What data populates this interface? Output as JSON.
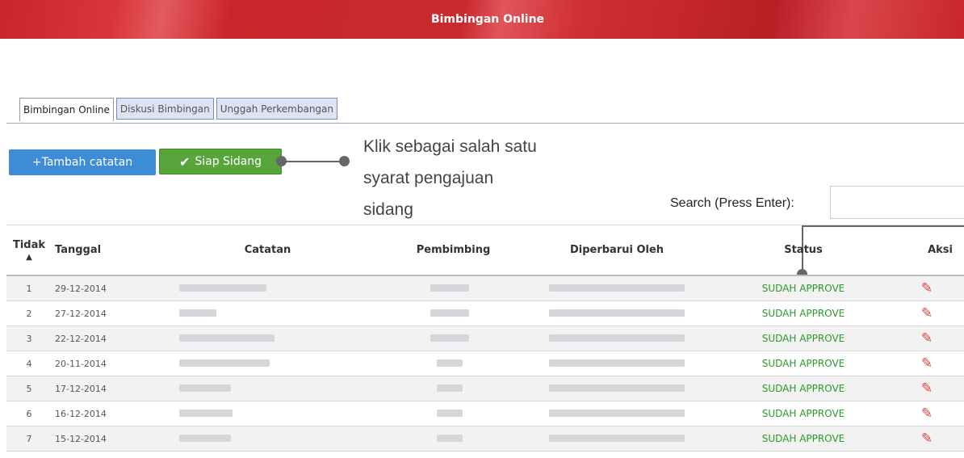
{
  "header": {
    "title": "Bimbingan Online"
  },
  "tabs": [
    {
      "label": "Bimbingan Online",
      "active": true
    },
    {
      "label": "Diskusi Bimbingan",
      "active": false
    },
    {
      "label": "Unggah Perkembangan",
      "active": false
    }
  ],
  "toolbar": {
    "add_label": "+Tambah catatan",
    "siap_label": "Siap Sidang"
  },
  "callout": {
    "line1": "Klik sebagai salah satu",
    "line2": "syarat pengajuan",
    "line3": "sidang"
  },
  "search": {
    "label": "Search (Press Enter):",
    "value": ""
  },
  "table": {
    "columns": [
      "Tidak",
      "Tanggal",
      "Catatan",
      "Pembimbing",
      "Diperbarui Oleh",
      "Status",
      "Aksi"
    ],
    "rows": [
      {
        "no": "1",
        "tanggal": "29-12-2014",
        "status": "SUDAH APPROVE"
      },
      {
        "no": "2",
        "tanggal": "27-12-2014",
        "status": "SUDAH APPROVE"
      },
      {
        "no": "3",
        "tanggal": "22-12-2014",
        "status": "SUDAH APPROVE"
      },
      {
        "no": "4",
        "tanggal": "20-11-2014",
        "status": "SUDAH APPROVE"
      },
      {
        "no": "5",
        "tanggal": "17-12-2014",
        "status": "SUDAH APPROVE"
      },
      {
        "no": "6",
        "tanggal": "16-12-2014",
        "status": "SUDAH APPROVE"
      },
      {
        "no": "7",
        "tanggal": "15-12-2014",
        "status": "SUDAH APPROVE"
      }
    ]
  },
  "colors": {
    "banner": "#c9252c",
    "add_button": "#3c8dd6",
    "siap_button": "#58a63b",
    "status_text": "#2a9b2a"
  },
  "icons": {
    "checkmark": "check-icon",
    "edit": "pencil-icon",
    "sort": "sort-up-icon"
  }
}
